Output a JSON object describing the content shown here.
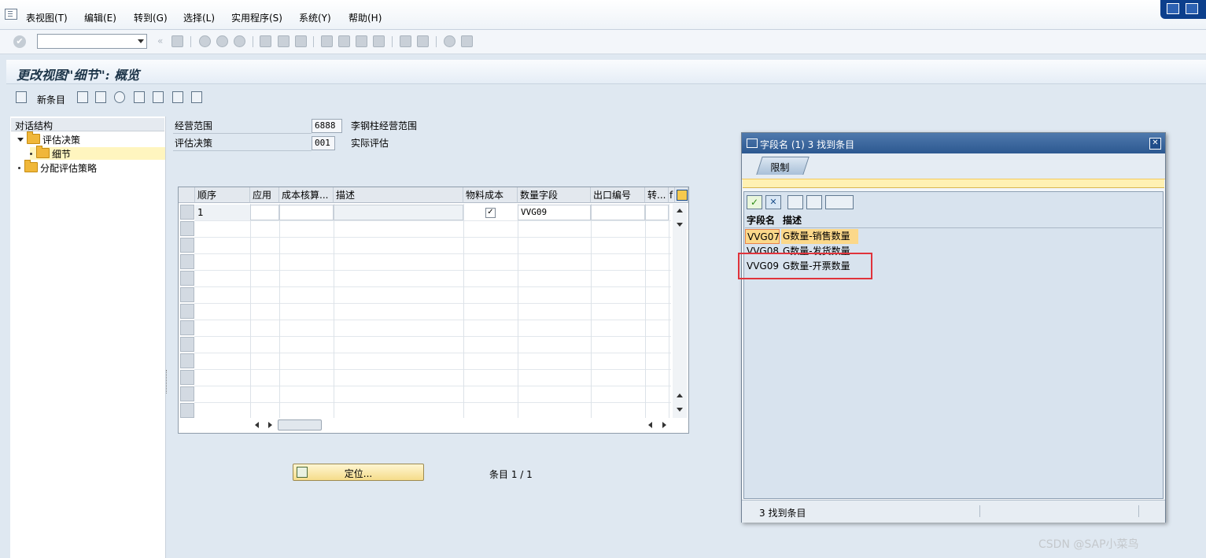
{
  "menu": {
    "items": [
      "表视图(T)",
      "编辑(E)",
      "转到(G)",
      "选择(L)",
      "实用程序(S)",
      "系统(Y)",
      "帮助(H)"
    ]
  },
  "toolbar": {
    "command_field_value": "",
    "icons": [
      "enter-icon",
      "save-icon",
      "back-icon",
      "exit-icon",
      "cancel-icon",
      "print-icon",
      "find-icon",
      "find-next-icon",
      "first-page-icon",
      "previous-page-icon",
      "next-page-icon",
      "last-page-icon",
      "create-session-icon",
      "shortcut-icon",
      "help-icon",
      "layout-icon"
    ]
  },
  "title": "更改视图\"细节\": 概览",
  "app_toolbar": {
    "new_entries_label": "新条目"
  },
  "tree": {
    "header": "对话结构",
    "nodes": [
      {
        "label": "评估决策",
        "expanded": true
      },
      {
        "label": "细节",
        "selected": true
      },
      {
        "label": "分配评估策略"
      }
    ]
  },
  "fields": {
    "area": {
      "label": "经营范围",
      "value": "6888",
      "desc": "李钢柱经营范围"
    },
    "decision": {
      "label": "评估决策",
      "value": "001",
      "desc": "实际评估"
    }
  },
  "table": {
    "columns": [
      "顺序",
      "应用",
      "成本核算...",
      "描述",
      "物料成本",
      "数量字段",
      "出口编号",
      "转...",
      "f"
    ],
    "rows": [
      {
        "seq": "1",
        "app": "",
        "costing": "",
        "desc": "",
        "material_cost": true,
        "qty_field": "VVG09",
        "export_no": "",
        "conv": ""
      }
    ]
  },
  "locate_button": "定位...",
  "entry_info": "条目 1 / 1",
  "popup": {
    "title": "字段名 (1)   3 找到条目",
    "tab": "限制",
    "columns": [
      "字段名",
      "描述"
    ],
    "rows": [
      {
        "name": "VVG07",
        "desc": "G数量-销售数量",
        "highlight": true
      },
      {
        "name": "VVG08",
        "desc": "G数量-发货数量"
      },
      {
        "name": "VVG09",
        "desc": "G数量-开票数量"
      }
    ],
    "status": "3 找到条目"
  },
  "watermark": "CSDN @SAP小菜鸟"
}
